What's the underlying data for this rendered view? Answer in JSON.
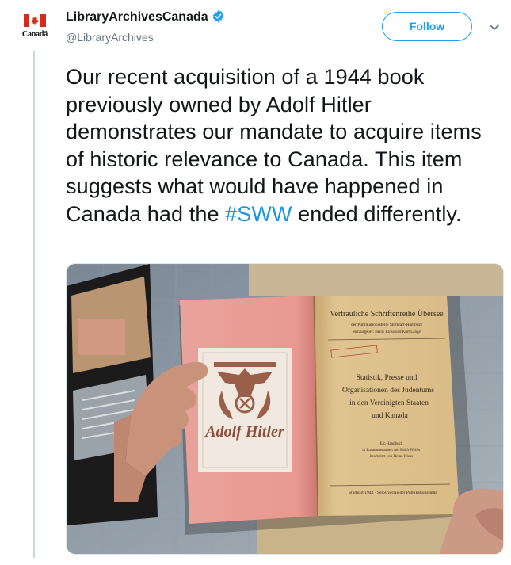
{
  "account": {
    "name": "LibraryArchivesCanada",
    "handle": "@LibraryArchives",
    "avatar_wordmark": "Canadä",
    "verified": true,
    "verified_icon": "verified-badge-icon"
  },
  "actions": {
    "follow_label": "Follow",
    "menu_icon": "chevron-down-icon"
  },
  "tweet": {
    "text_before": "Our recent acquisition of a 1944 book previously owned by Adolf Hitler demonstrates our mandate to acquire items of historic relevance to Canada. This item suggests what would have happened in Canada had the ",
    "hashtag": "#SWW",
    "text_after": " ended differently."
  },
  "media": {
    "bookplate_text": "Adolf Hitler",
    "title_page": {
      "series": "Vertrauliche Schriftenreihe Übersee",
      "publisher_line": "der Publikationsstelle Stuttgart-Hamburg",
      "editors_line": "Herausgeber: Heinz Kloss und Kurt Lange",
      "title_lines": [
        "Statistik, Presse und",
        "Organisationen des Judentums",
        "in den Vereinigten Staaten",
        "und Kanada"
      ],
      "subtitle_lines": [
        "Ein Handbuch",
        "in Zusammenarbeit mit Edith Pfeifer",
        "bearbeitet von Heinz Kloss"
      ],
      "footer": "Stuttgart 1944 · Selbstverlag der Publikationsstelle"
    }
  },
  "colors": {
    "accent": "#1da1f2",
    "hashtag": "#1b95e0",
    "text": "#14171a",
    "muted": "#657786",
    "flag_red": "#d52b1e"
  }
}
